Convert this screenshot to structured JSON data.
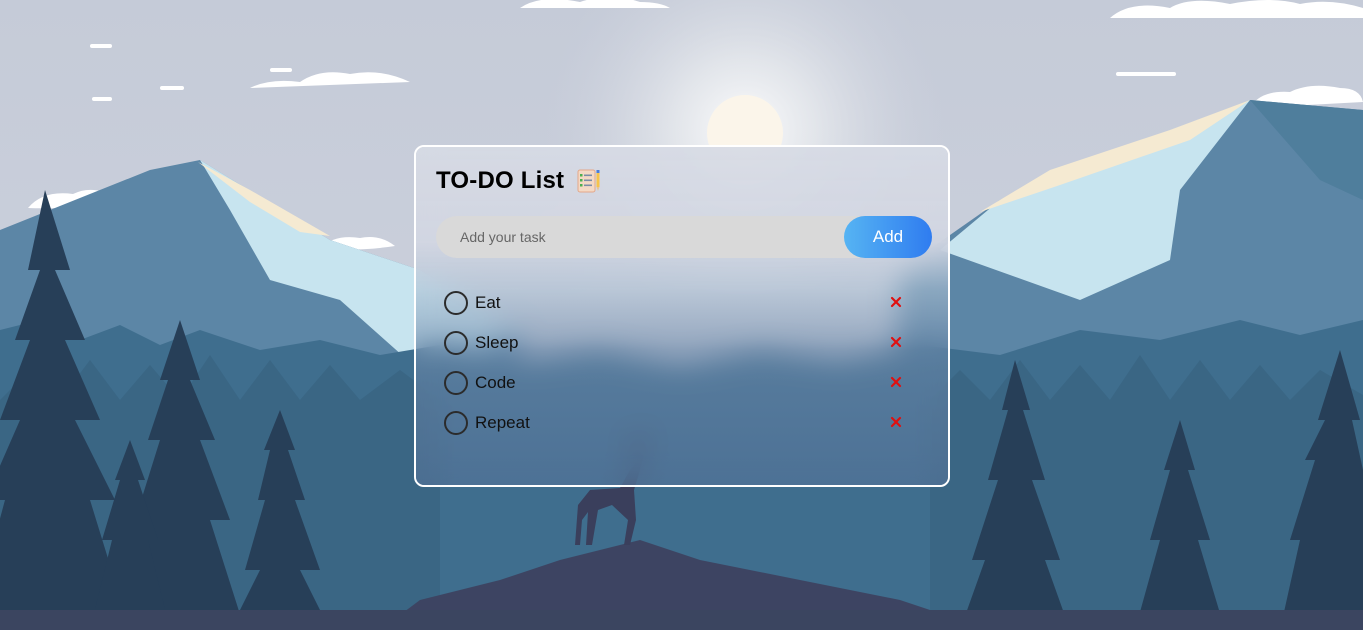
{
  "app": {
    "title": "TO-DO List",
    "title_icon": "checklist-pencil-icon"
  },
  "input": {
    "placeholder": "Add your task",
    "value": ""
  },
  "add_button": {
    "label": "Add"
  },
  "tasks": [
    {
      "label": "Eat",
      "checked": false,
      "delete_icon": "close-icon"
    },
    {
      "label": "Sleep",
      "checked": false,
      "delete_icon": "close-icon"
    },
    {
      "label": "Code",
      "checked": false,
      "delete_icon": "close-icon"
    },
    {
      "label": "Repeat",
      "checked": false,
      "delete_icon": "close-icon"
    }
  ],
  "colors": {
    "accent_start": "#56b4f3",
    "accent_end": "#2f7cf0",
    "delete": "#e01010",
    "input_bg": "#d9d9d9"
  }
}
